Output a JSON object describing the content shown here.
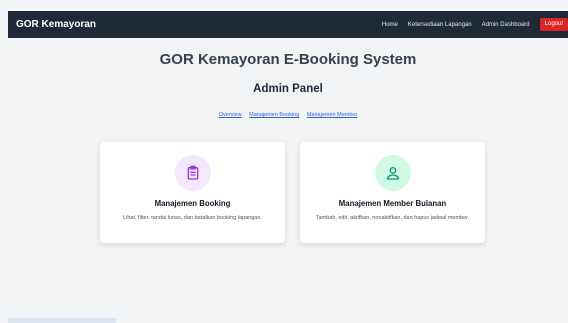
{
  "navbar": {
    "brand": "GOR Kemayoran",
    "links": [
      "Home",
      "Ketersediaan Lapangan",
      "Admin Dashboard"
    ],
    "logout": "Logout",
    "logout_color": "#dc2626",
    "background": "#1f2937"
  },
  "page": {
    "title": "GOR Kemayoran E-Booking System",
    "subtitle": "Admin Panel",
    "subnav": [
      "Overview",
      "Manajemen Booking",
      "Manajemen Member"
    ]
  },
  "cards": [
    {
      "icon": "clipboard-icon",
      "title": "Manajemen Booking",
      "description": "Lihat, filter, tandai lunas, dan batalkan booking lapangan.",
      "icon_color": "#9333ea"
    },
    {
      "icon": "user-icon",
      "title": "Manajemen Member Bulanan",
      "description": "Tambah, edit, aktifkan, nonaktifkan, dan hapus jadwal member.",
      "icon_color": "#059669"
    }
  ]
}
